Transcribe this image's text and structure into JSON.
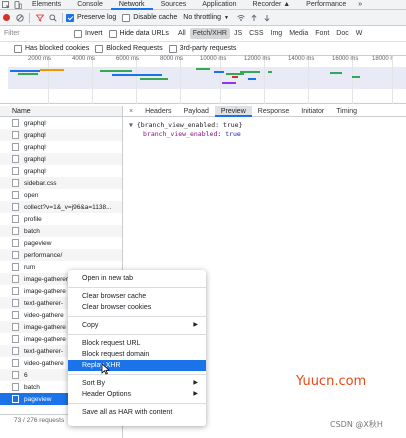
{
  "topbar": {
    "tabs": [
      {
        "label": "Elements"
      },
      {
        "label": "Console"
      },
      {
        "label": "Network",
        "active": true
      },
      {
        "label": "Sources"
      },
      {
        "label": "Application"
      },
      {
        "label": "Recorder ▲"
      },
      {
        "label": "Performance"
      }
    ],
    "more": "»"
  },
  "toolbar": {
    "preserve_log": "Preserve log",
    "disable_cache": "Disable cache",
    "throttling": "No throttling"
  },
  "filterbar": {
    "filter_placeholder": "Filter",
    "invert": "Invert",
    "hide_data_urls": "Hide data URLs",
    "types": [
      "All",
      "Fetch/XHR",
      "JS",
      "CSS",
      "Img",
      "Media",
      "Font",
      "Doc",
      "W"
    ],
    "active_type": "Fetch/XHR"
  },
  "filterbar2": {
    "has_blocked_cookies": "Has blocked cookies",
    "blocked_requests": "Blocked Requests",
    "third_party": "3rd-party requests"
  },
  "overview": {
    "ticks": [
      "2000 ms",
      "4000 ms",
      "6000 ms",
      "8000 ms",
      "10000 ms",
      "12000 ms",
      "14000 ms",
      "16000 ms",
      "18000 r"
    ]
  },
  "request_list": {
    "column_name": "Name",
    "rows": [
      "graphql",
      "graphql",
      "graphql",
      "graphql",
      "graphql",
      "sidebar.css",
      "open",
      "collect?v=1&_v=j96&a=1138...",
      "profile",
      "batch",
      "pageview",
      "performance/",
      "rum",
      "image-gatherer",
      "image-gathere",
      "text-gatherer-",
      "video-gathere",
      "image-gathere",
      "image-gathere",
      "text-gatherer-",
      "video-gathere",
      "6",
      "batch",
      "pageview"
    ],
    "selected_index": 23,
    "status": "73 / 276 requests"
  },
  "detail": {
    "tabs": [
      "Headers",
      "Payload",
      "Preview",
      "Response",
      "Initiator",
      "Timing"
    ],
    "active_tab": "Preview",
    "close": "×",
    "preview_root": "{branch_view_enabled: true}",
    "preview_key": "branch_view_enabled",
    "preview_value": "true"
  },
  "context_menu": {
    "items": [
      {
        "label": "Open in new tab"
      },
      {
        "sep": true
      },
      {
        "label": "Clear browser cache"
      },
      {
        "label": "Clear browser cookies"
      },
      {
        "sep": true
      },
      {
        "label": "Copy",
        "submenu": true
      },
      {
        "sep": true
      },
      {
        "label": "Block request URL"
      },
      {
        "label": "Block request domain"
      },
      {
        "label": "Replay XHR",
        "highlighted": true
      },
      {
        "sep": true
      },
      {
        "label": "Sort By",
        "submenu": true
      },
      {
        "label": "Header Options",
        "submenu": true
      },
      {
        "sep": true
      },
      {
        "label": "Save all as HAR with content"
      }
    ]
  },
  "watermark": "Yuucn.com",
  "csdn": "CSDN @X秋H",
  "colors": {
    "accent": "#1a73e8",
    "record": "#d93025",
    "watermark": "#e64a19"
  }
}
